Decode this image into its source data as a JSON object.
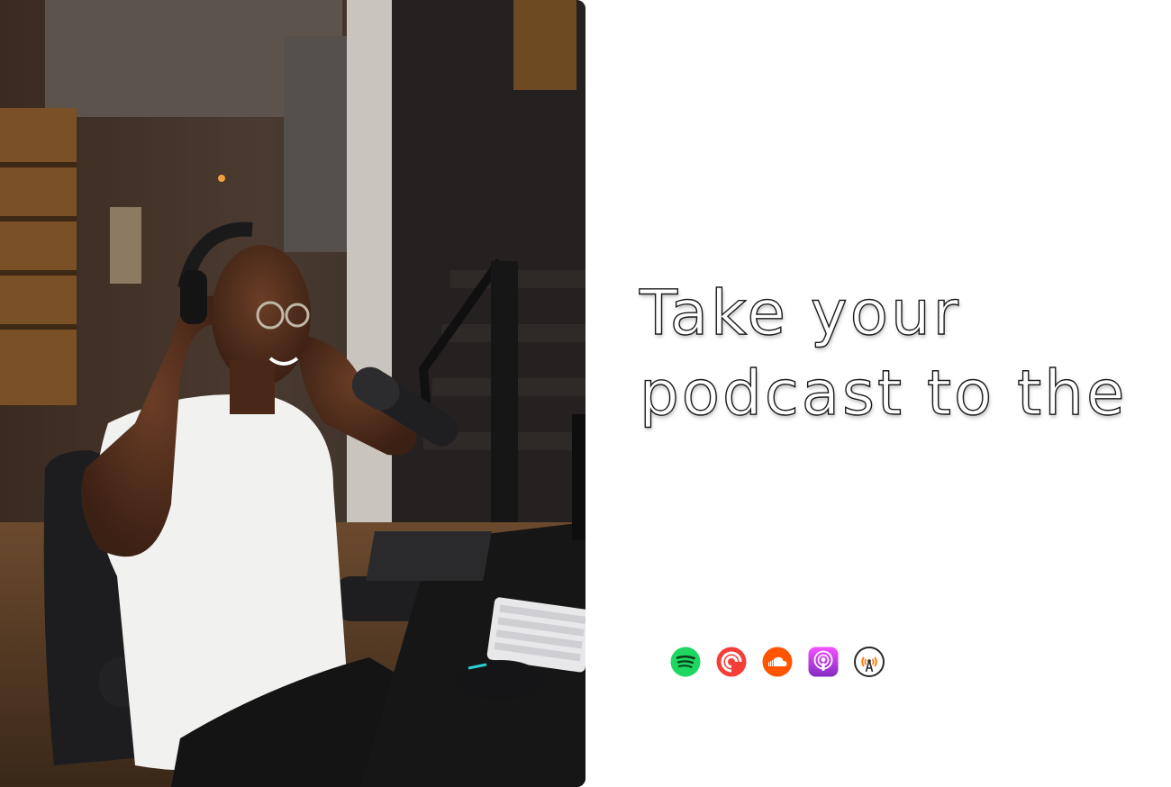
{
  "hero": {
    "image_alt": "Man wearing headphones and glasses smiling at a podcast microphone in a studio"
  },
  "headline": {
    "line1": "Take your",
    "line2": "podcast to the"
  },
  "platforms": [
    {
      "icon": "spotify-icon",
      "color": "#1ED760"
    },
    {
      "icon": "pocket-casts-icon",
      "color": "#F43E37"
    },
    {
      "icon": "soundcloud-icon",
      "color": "#FF5500"
    },
    {
      "icon": "apple-podcasts-icon",
      "color": "#9933CC"
    },
    {
      "icon": "overcast-icon",
      "color": "#FC7E0F"
    }
  ],
  "colors": {
    "background": "#FFFFFF",
    "headline_fill": "#FFFFFF",
    "headline_stroke": "#1A1A1A"
  }
}
